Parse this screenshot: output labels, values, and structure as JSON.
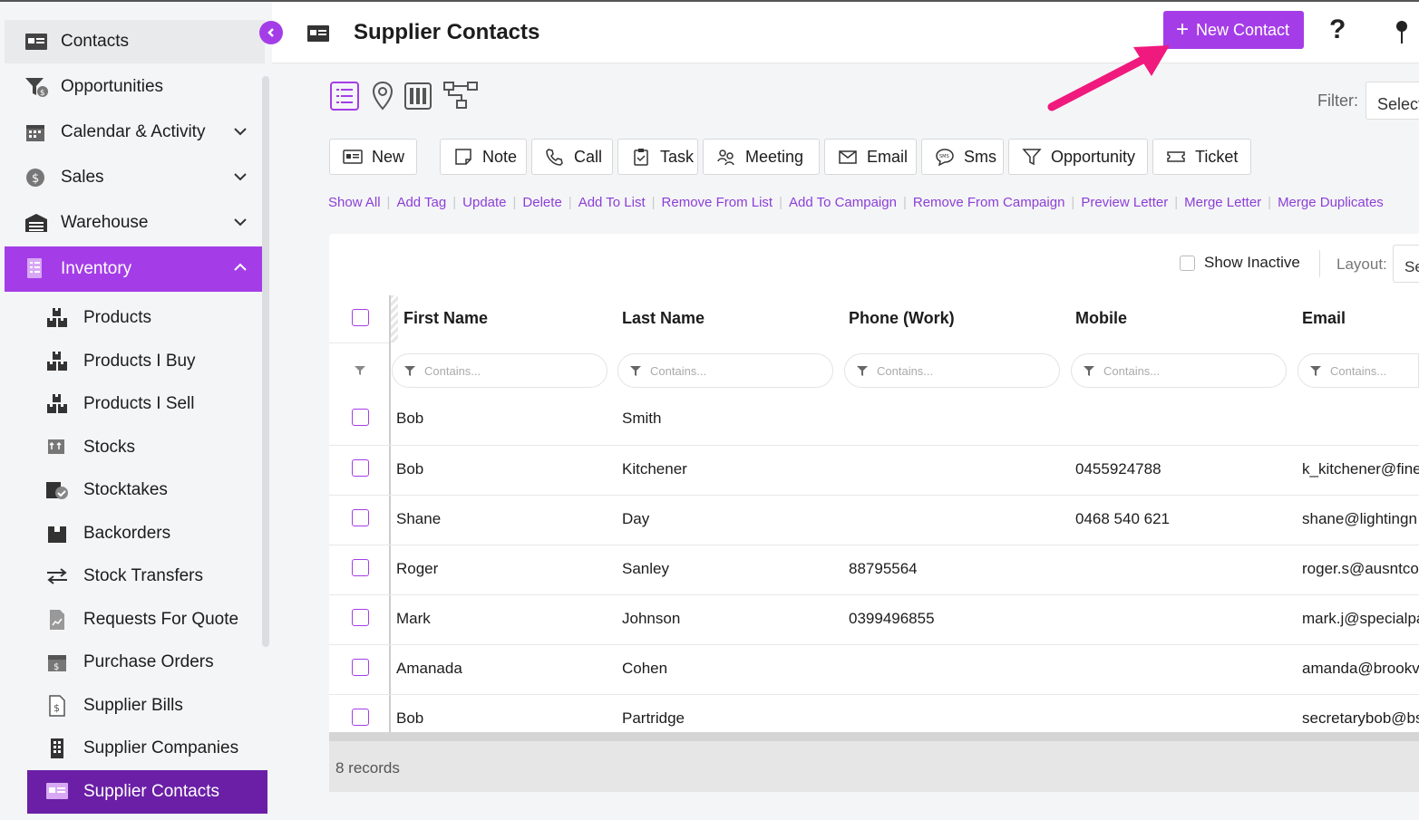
{
  "sidebar": {
    "items": [
      {
        "label": "Contacts",
        "icon": "contact-card-icon"
      },
      {
        "label": "Opportunities",
        "icon": "funnel-dollar-icon"
      },
      {
        "label": "Calendar & Activity",
        "icon": "calendar-icon"
      },
      {
        "label": "Sales",
        "icon": "dollar-coin-icon"
      },
      {
        "label": "Warehouse",
        "icon": "warehouse-icon"
      },
      {
        "label": "Inventory",
        "icon": "checklist-icon"
      }
    ],
    "sub_items": [
      {
        "label": "Products",
        "icon": "boxes-icon"
      },
      {
        "label": "Products I Buy",
        "icon": "boxes-icon"
      },
      {
        "label": "Products I Sell",
        "icon": "boxes-icon"
      },
      {
        "label": "Stocks",
        "icon": "stocks-icon"
      },
      {
        "label": "Stocktakes",
        "icon": "stocktake-icon"
      },
      {
        "label": "Backorders",
        "icon": "box-icon"
      },
      {
        "label": "Stock Transfers",
        "icon": "transfer-arrows-icon"
      },
      {
        "label": "Requests For Quote",
        "icon": "document-chart-icon"
      },
      {
        "label": "Purchase Orders",
        "icon": "box-dollar-icon"
      },
      {
        "label": "Supplier Bills",
        "icon": "bill-dollar-icon"
      },
      {
        "label": "Supplier Companies",
        "icon": "building-icon"
      },
      {
        "label": "Supplier Contacts",
        "icon": "contact-card-icon"
      }
    ]
  },
  "header": {
    "title": "Supplier Contacts",
    "new_contact_label": "New Contact",
    "help_label": "?"
  },
  "filter": {
    "label": "Filter:",
    "value": "Select"
  },
  "actions": [
    {
      "label": "New",
      "icon": "contact-card-icon"
    },
    {
      "label": "Note",
      "icon": "note-icon"
    },
    {
      "label": "Call",
      "icon": "phone-icon"
    },
    {
      "label": "Task",
      "icon": "clipboard-icon"
    },
    {
      "label": "Meeting",
      "icon": "meeting-icon"
    },
    {
      "label": "Email",
      "icon": "envelope-icon"
    },
    {
      "label": "Sms",
      "icon": "sms-icon"
    },
    {
      "label": "Opportunity",
      "icon": "funnel-icon"
    },
    {
      "label": "Ticket",
      "icon": "ticket-icon"
    }
  ],
  "links": [
    "Show All",
    "Add Tag",
    "Update",
    "Delete",
    "Add To List",
    "Remove From List",
    "Add To Campaign",
    "Remove From Campaign",
    "Preview Letter",
    "Merge Letter",
    "Merge Duplicates"
  ],
  "grid": {
    "show_inactive_label": "Show Inactive",
    "layout_label": "Layout:",
    "layout_value": "Se",
    "columns": [
      "First Name",
      "Last Name",
      "Phone (Work)",
      "Mobile",
      "Email"
    ],
    "filter_placeholder": "Contains...",
    "rows": [
      [
        "Bob",
        "Smith",
        "",
        "",
        ""
      ],
      [
        "Bob",
        "Kitchener",
        "",
        "0455924788",
        "k_kitchener@fine"
      ],
      [
        "Shane",
        "Day",
        "",
        "0468 540 621",
        "shane@lightingn"
      ],
      [
        "Roger",
        "Sanley",
        "88795564",
        "",
        "roger.s@ausntco."
      ],
      [
        "Mark",
        "Johnson",
        "0399496855",
        "",
        "mark.j@specialpa"
      ],
      [
        "Amanada",
        "Cohen",
        "",
        "",
        "amanda@brookv"
      ],
      [
        "Bob",
        "Partridge",
        "",
        "",
        "secretarybob@bs"
      ]
    ],
    "record_count": "8 records"
  },
  "colors": {
    "accent": "#a43de7",
    "accent_dark": "#6a1fa6",
    "arrow": "#f0197d"
  }
}
